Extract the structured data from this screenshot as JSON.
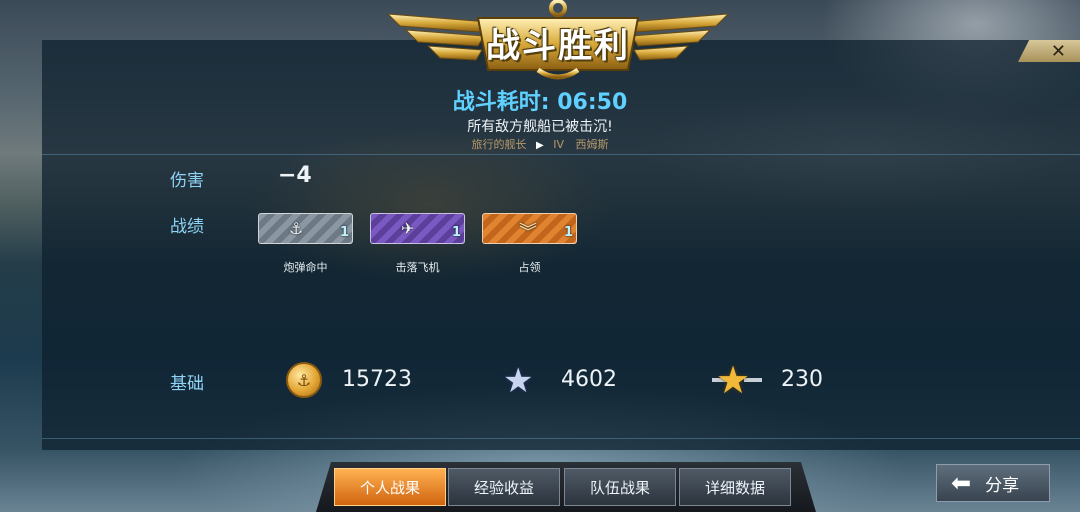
{
  "header": {
    "title": "战斗胜利",
    "duration_label": "战斗耗时:",
    "duration_value": "06:50",
    "summary": "所有敌方舰船已被击沉!",
    "captain": "旅行的舰长",
    "tier": "IV",
    "ship": "西姆斯"
  },
  "close_icon": "close-icon",
  "stats": {
    "damage_label": "伤害",
    "damage_value": "−4",
    "achievements_label": "战绩",
    "achievements": [
      {
        "name": "炮弹命中",
        "count": "1",
        "color": "silver",
        "icon": "torpedo-hit-icon"
      },
      {
        "name": "击落飞机",
        "count": "1",
        "color": "purple",
        "icon": "plane-down-icon"
      },
      {
        "name": "占领",
        "count": "1",
        "color": "orange",
        "icon": "capture-chevron-icon"
      }
    ]
  },
  "rewards": {
    "label": "基础",
    "credits": "15723",
    "experience": "4602",
    "commander_exp": "230"
  },
  "tabs": [
    {
      "label": "个人战果",
      "active": true
    },
    {
      "label": "经验收益",
      "active": false
    },
    {
      "label": "队伍战果",
      "active": false
    },
    {
      "label": "详细数据",
      "active": false
    }
  ],
  "share": {
    "label": "分享"
  }
}
